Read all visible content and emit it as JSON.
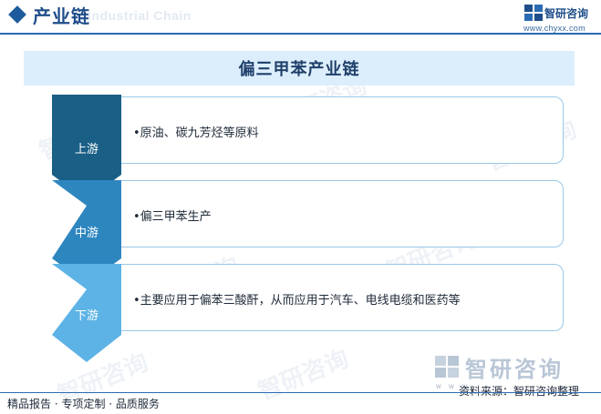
{
  "header": {
    "title": "产业链",
    "ghost_text": "Industrial Chain",
    "logo_name": "智研咨询",
    "logo_url": "www.chyxx.com"
  },
  "diagram": {
    "title": "偏三甲苯产业链",
    "stages": [
      {
        "label": "上游",
        "text": "•原油、碳九芳烃等原料",
        "color": "#1a5f86"
      },
      {
        "label": "中游",
        "text": "•偏三甲苯生产",
        "color": "#2e86bf"
      },
      {
        "label": "下游",
        "text": "•主要应用于偏苯三酸酐，从而应用于汽车、电线电缆和医药等",
        "color": "#5db3e6"
      }
    ]
  },
  "footer": {
    "logo_name": "智研咨询",
    "logo_small": "w w w",
    "source": "资料来源：智研咨询整理",
    "tagline": "精品报告 · 专项定制 · 品质服务"
  },
  "watermark": "智研咨询"
}
